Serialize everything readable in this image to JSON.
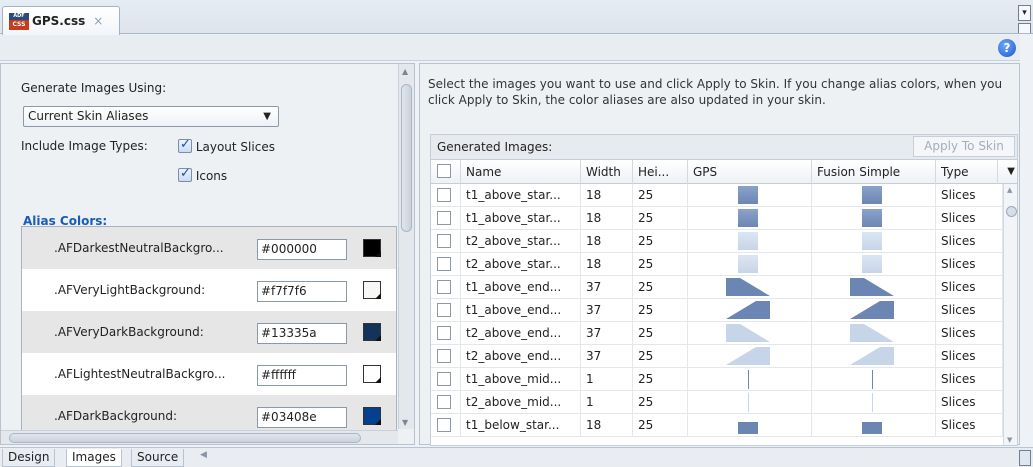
{
  "document_tab": {
    "title": "GPS.css",
    "icon_top": "ADF",
    "icon_bottom": "CSS",
    "close": "×"
  },
  "help": "?",
  "left": {
    "generate_label": "Generate Images Using:",
    "generate_value": "Current Skin Aliases",
    "include_label": "Include Image Types:",
    "opt_layout": "Layout Slices",
    "opt_icons": "Icons",
    "alias_link": "Alias Colors",
    "alias_link_suffix": ":",
    "aliases": [
      {
        "name": ".AFDarkestNeutralBackgro...",
        "hex": "#000000",
        "color": "#000000"
      },
      {
        "name": ".AFVeryLightBackground:",
        "hex": "#f7f7f6",
        "color": "#f7f7f6"
      },
      {
        "name": ".AFVeryDarkBackground:",
        "hex": "#13335a",
        "color": "#13335a"
      },
      {
        "name": ".AFLightestNeutralBackgro...",
        "hex": "#ffffff",
        "color": "#ffffff"
      },
      {
        "name": ".AFDarkBackground:",
        "hex": "#03408e",
        "color": "#03408e"
      }
    ]
  },
  "right": {
    "instructions": "Select the images you want to use and click Apply to Skin. If you change alias colors, when you click Apply to Skin, the color aliases are also updated in your skin.",
    "generated_label": "Generated Images:",
    "apply_button": "Apply To Skin",
    "columns": [
      "Name",
      "Width",
      "Hei...",
      "GPS",
      "Fusion Simple",
      "Type"
    ],
    "rows": [
      {
        "name": "t1_above_star...",
        "width": "18",
        "height": "25",
        "shape": "rect-dark",
        "type": "Slices"
      },
      {
        "name": "t1_above_star...",
        "width": "18",
        "height": "25",
        "shape": "rect-dark",
        "type": "Slices"
      },
      {
        "name": "t2_above_star...",
        "width": "18",
        "height": "25",
        "shape": "rect-light",
        "type": "Slices"
      },
      {
        "name": "t2_above_star...",
        "width": "18",
        "height": "25",
        "shape": "rect-light",
        "type": "Slices"
      },
      {
        "name": "t1_above_end...",
        "width": "37",
        "height": "25",
        "shape": "wedge-down",
        "type": "Slices"
      },
      {
        "name": "t1_above_end...",
        "width": "37",
        "height": "25",
        "shape": "wedge-up",
        "type": "Slices"
      },
      {
        "name": "t2_above_end...",
        "width": "37",
        "height": "25",
        "shape": "wedge-down-light",
        "type": "Slices"
      },
      {
        "name": "t2_above_end...",
        "width": "37",
        "height": "25",
        "shape": "wedge-up-light",
        "type": "Slices"
      },
      {
        "name": "t1_above_mid...",
        "width": "1",
        "height": "25",
        "shape": "line",
        "type": "Slices"
      },
      {
        "name": "t2_above_mid...",
        "width": "1",
        "height": "25",
        "shape": "line-light",
        "type": "Slices"
      },
      {
        "name": "t1_below_star...",
        "width": "18",
        "height": "25",
        "shape": "rect-bottom",
        "type": "Slices"
      }
    ]
  },
  "bottom_tabs": [
    "Design",
    "Images",
    "Source"
  ],
  "colors": {
    "slice_dark": "#6b86b3",
    "slice_light": "#c7d5e8",
    "link": "#1a5bb8"
  }
}
